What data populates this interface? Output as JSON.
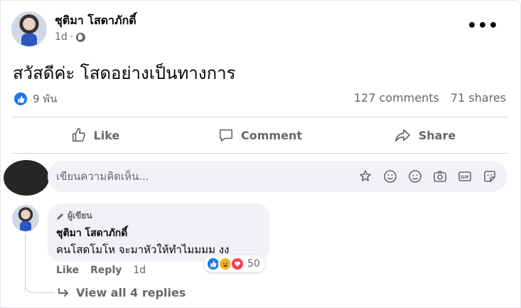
{
  "post": {
    "author": "ชุติมา โสดาภักดิ์",
    "time": "1d",
    "text": "สวัสดีค่ะ โสดอย่างเป็นทางการ",
    "like_count": "9 พัน",
    "comments": "127 comments",
    "shares": "71 shares"
  },
  "actions": {
    "like": "Like",
    "comment": "Comment",
    "share": "Share"
  },
  "composer": {
    "placeholder": "เขียนความคิดเห็น..."
  },
  "comment": {
    "badge": "ผู้เขียน",
    "author": "ชุติมา โสดาภักดิ์",
    "text": "คนโสดโมโห จะมาหัวให้ทำไมมมม งง",
    "reaction_count": "50",
    "like": "Like",
    "reply": "Reply",
    "time": "1d",
    "view_replies": "View all 4 replies"
  },
  "colors": {
    "brand_blue": "#1877f2",
    "secondary_text": "#65676b",
    "input_bg": "#f0f2f5"
  }
}
